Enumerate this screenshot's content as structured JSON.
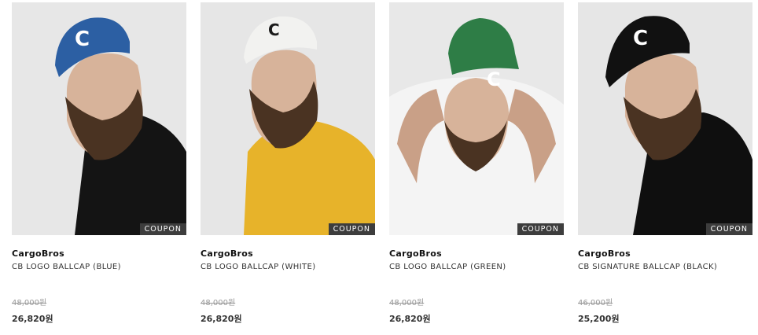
{
  "products": [
    {
      "brand": "CargoBros",
      "name": "CB LOGO BALLCAP (BLUE)",
      "original_price": "48,000원",
      "sale_price": "26,820원",
      "badge": "COUPON",
      "cap_color": "#2c5fa3",
      "shirt_color": "#141414"
    },
    {
      "brand": "CargoBros",
      "name": "CB LOGO BALLCAP (WHITE)",
      "original_price": "48,000원",
      "sale_price": "26,820원",
      "badge": "COUPON",
      "cap_color": "#f2f2f0",
      "shirt_color": "#e7b32a"
    },
    {
      "brand": "CargoBros",
      "name": "CB LOGO BALLCAP (GREEN)",
      "original_price": "48,000원",
      "sale_price": "26,820원",
      "badge": "COUPON",
      "cap_color": "#2e7d46",
      "shirt_color": "#f4f4f4"
    },
    {
      "brand": "CargoBros",
      "name": "CB SIGNATURE BALLCAP (BLACK)",
      "original_price": "46,000원",
      "sale_price": "25,200원",
      "badge": "COUPON",
      "cap_color": "#111111",
      "shirt_color": "#0f0f0f"
    }
  ]
}
